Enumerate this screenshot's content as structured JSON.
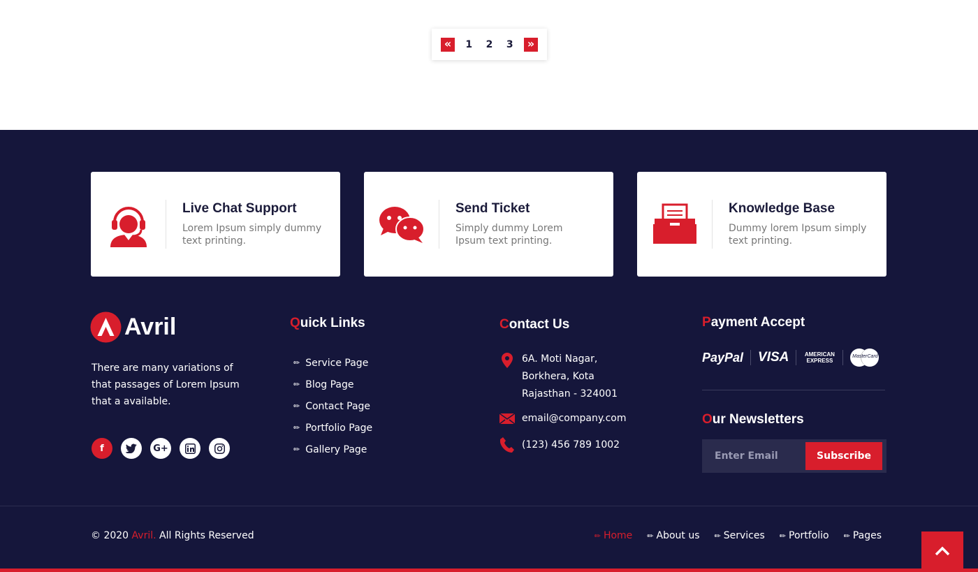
{
  "pagination": {
    "prev": "«",
    "pages": [
      "1",
      "2",
      "3"
    ],
    "next": "»"
  },
  "cards": [
    {
      "title": "Live Chat Support",
      "desc": "Lorem Ipsum simply dummy text printing.",
      "icon": "headset-agent-icon"
    },
    {
      "title": "Send Ticket",
      "desc": "Simply dummy Lorem Ipsum text printing.",
      "icon": "chat-bubbles-icon"
    },
    {
      "title": "Knowledge Base",
      "desc": "Dummy lorem Ipsum simply text printing.",
      "icon": "document-basket-icon"
    }
  ],
  "brand": {
    "name": "Avril",
    "about": "There are many variations of that passages of Lorem Ipsum that a available."
  },
  "socials": [
    {
      "name": "facebook",
      "glyph": "f"
    },
    {
      "name": "twitter",
      "glyph": "t"
    },
    {
      "name": "google-plus",
      "glyph": "G+"
    },
    {
      "name": "linkedin",
      "glyph": "in"
    },
    {
      "name": "instagram",
      "glyph": "◎"
    }
  ],
  "quick_links": {
    "title_first": "Q",
    "title_rest": "uick Links",
    "items": [
      "Service Page",
      "Blog Page",
      "Contact Page",
      "Portfolio Page",
      "Gallery Page"
    ]
  },
  "contact": {
    "title_first": "C",
    "title_rest": "ontact Us",
    "address": [
      "6A. Moti Nagar,",
      "Borkhera, Kota",
      "Rajasthan - 324001"
    ],
    "email": "email@company.com",
    "phone": "(123) 456 789 1002"
  },
  "payment": {
    "title_first": "P",
    "title_rest": "ayment Accept",
    "methods": [
      "PayPal",
      "VISA",
      "AMERICAN EXPRESS",
      "MasterCard"
    ]
  },
  "newsletter": {
    "title_first": "O",
    "title_rest": "ur Newsletters",
    "placeholder": "Enter Email",
    "button": "Subscribe"
  },
  "copyright": {
    "prefix": "© 2020 ",
    "brand": "Avril.",
    "suffix": " All Rights Reserved"
  },
  "bottom_nav": [
    "Home",
    "About us",
    "Services",
    "Portfolio",
    "Pages"
  ],
  "colors": {
    "accent": "#d81e2c",
    "footer_bg": "#15163b",
    "text_dark": "#1b1b3a"
  }
}
